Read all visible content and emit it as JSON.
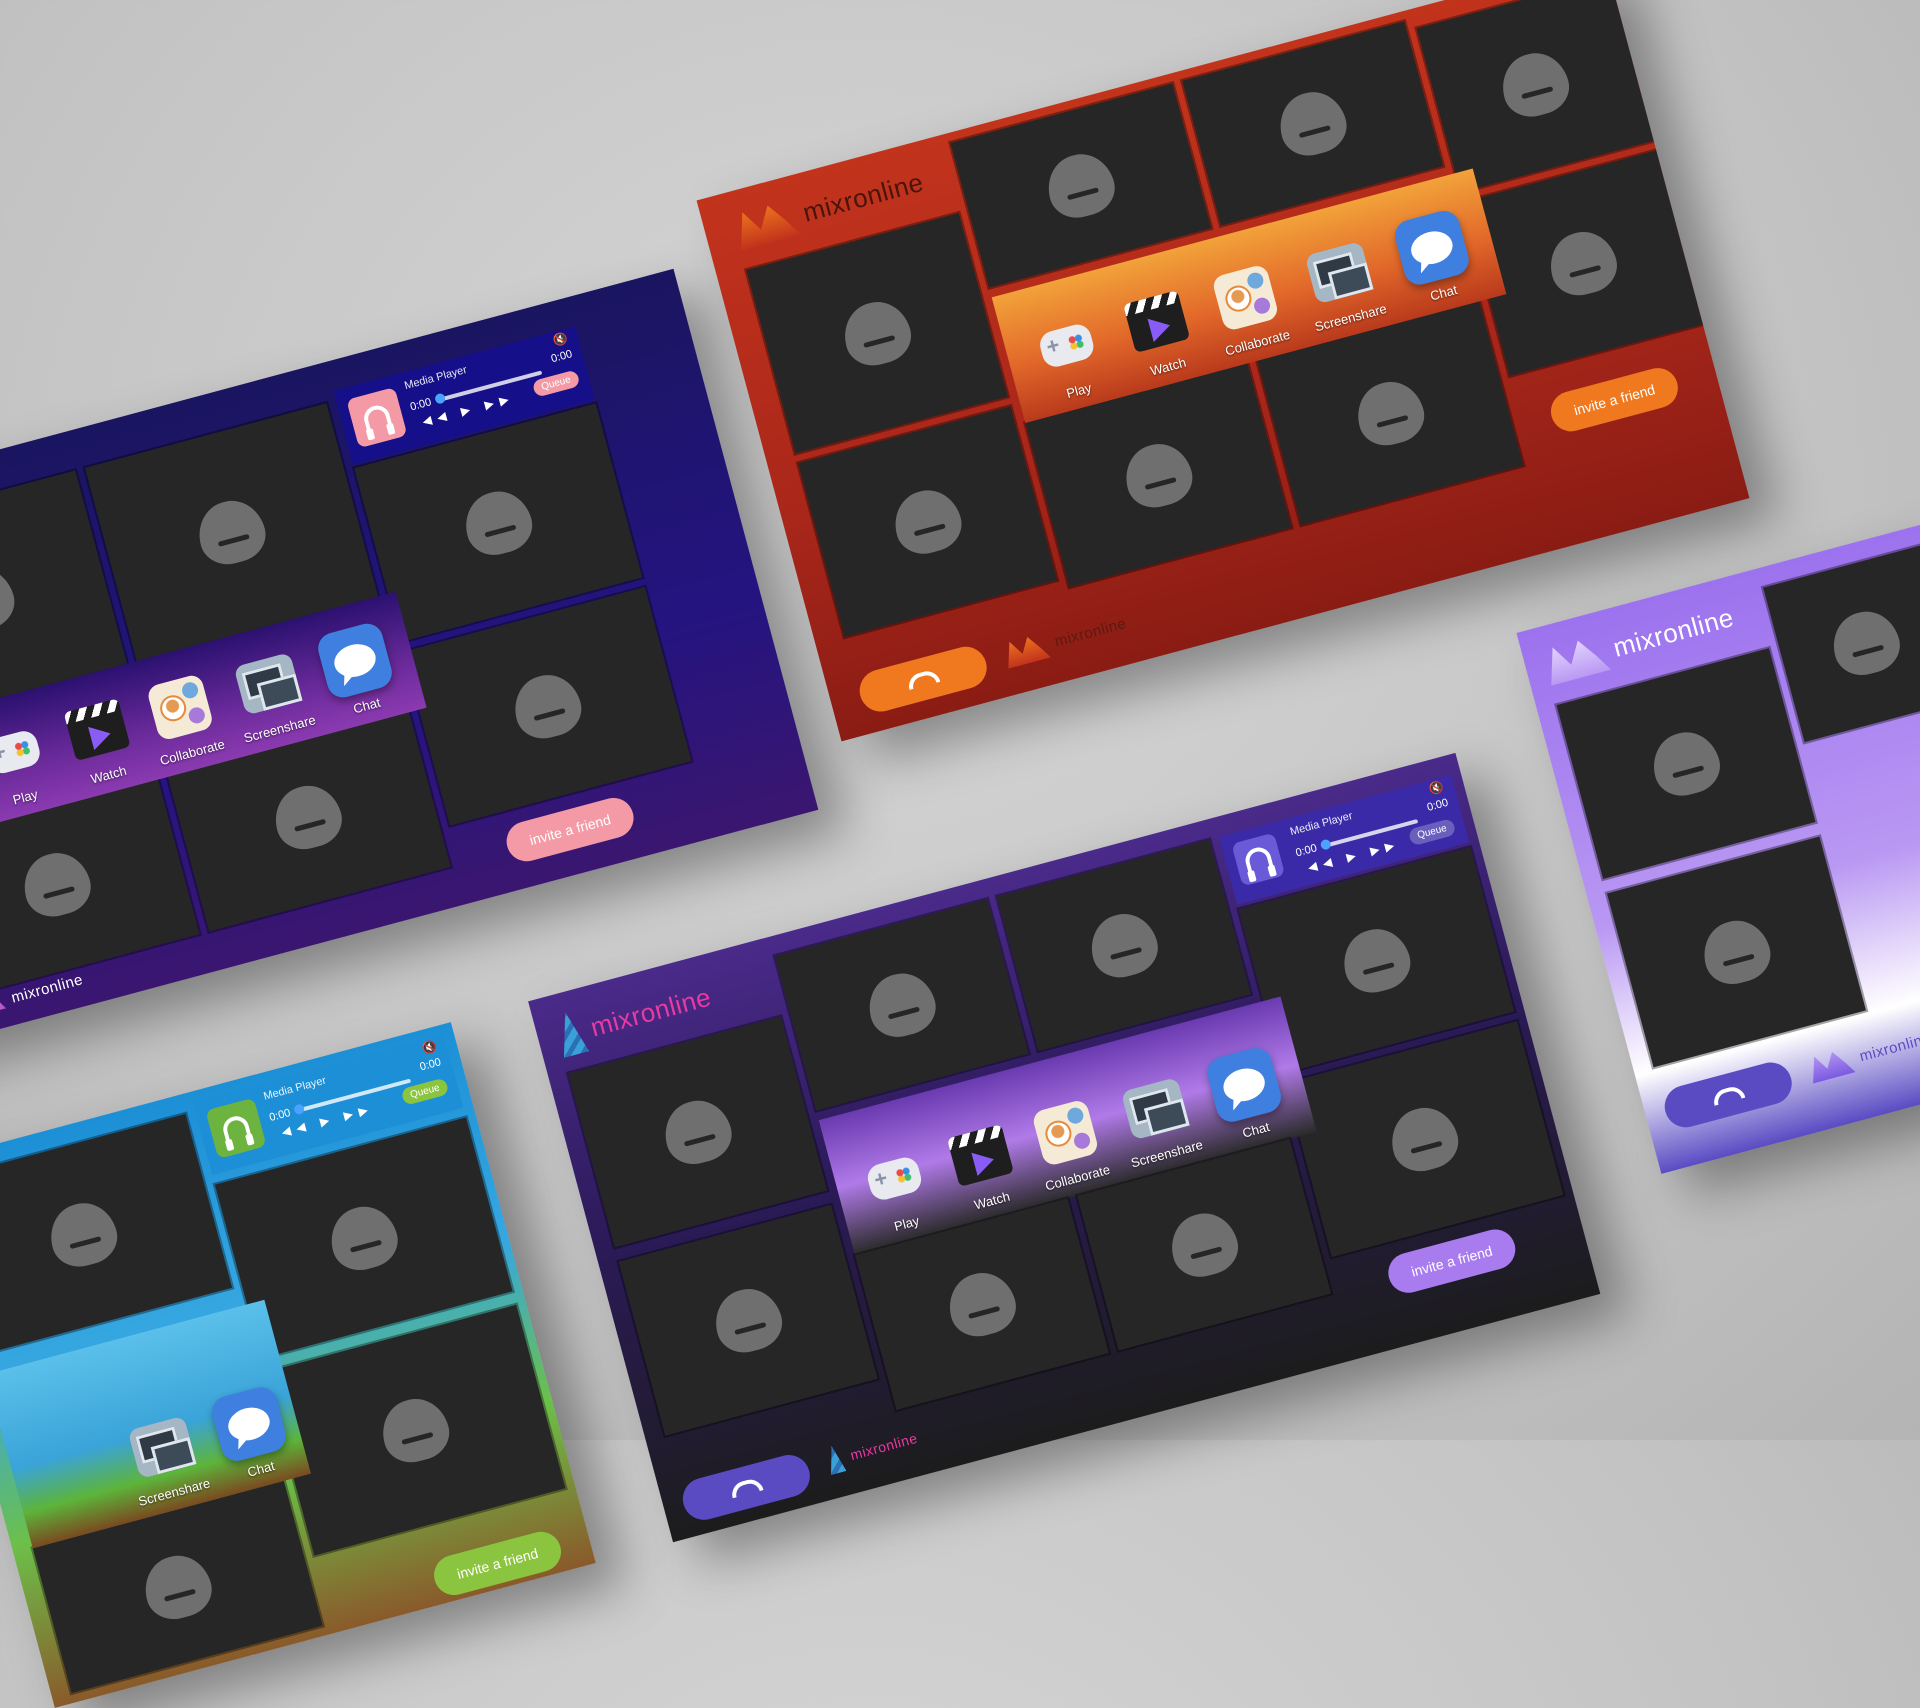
{
  "brand": {
    "name": "mixronline"
  },
  "apps": [
    {
      "label": "Play",
      "icon": "gamepad-icon"
    },
    {
      "label": "Watch",
      "icon": "clapperboard-icon"
    },
    {
      "label": "Collaborate",
      "icon": "collaborate-icon"
    },
    {
      "label": "Screenshare",
      "icon": "screenshare-icon"
    },
    {
      "label": "Chat",
      "icon": "chat-bubble-icon"
    }
  ],
  "player": {
    "title": "Media Player",
    "time_start": "0:00",
    "time_end": "0:00",
    "queue_label": "Queue",
    "controls": "◀◀ ▶ ▶▶",
    "mute_glyph": "🔇"
  },
  "invite_label": "invite a friend",
  "themes": {
    "synthwave": {
      "bg": "#1c1474",
      "accent": "#f49aa6"
    },
    "desert": {
      "bg": "#a8261a",
      "accent": "#f0781e"
    },
    "party": {
      "bg": "#2b1a58",
      "accent": "#a87bef"
    },
    "pixel": {
      "bg": "#1c8fd6",
      "accent": "#8bc53f"
    },
    "lilac": {
      "bg": "#9c72ee",
      "accent": "#5a4bc3"
    }
  }
}
